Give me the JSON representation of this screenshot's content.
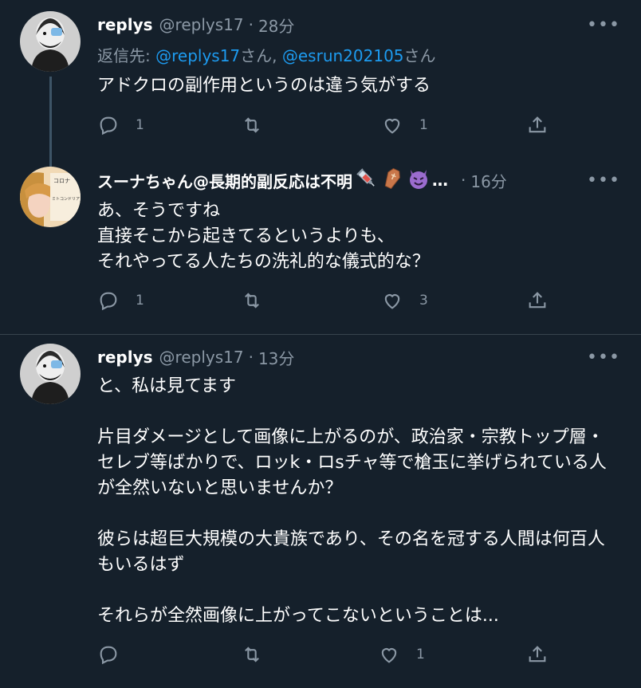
{
  "tweets": [
    {
      "name": "replys",
      "handle": "@replys17",
      "separator": "·",
      "time": "28分",
      "reply_prefix": "返信先: ",
      "reply_mention_1": "@replys17",
      "reply_san_1": "さん, ",
      "reply_mention_2": "@esrun202105",
      "reply_san_2": "さん",
      "text": "アドクロの副作用というのは違う気がする",
      "reply_count": "1",
      "retweet_count": "",
      "like_count": "1"
    },
    {
      "name": "スーナちゃん@長期的副反応は不明",
      "name_ellipsis": "…",
      "separator": "·",
      "time": "16分",
      "avatar_text": [
        "コロナ",
        "ミトコンドリア"
      ],
      "text": "あ、そうですね\n直接そこから起きてるというよりも、\nそれやってる人たちの洗礼的な儀式的な？",
      "reply_count": "1",
      "retweet_count": "",
      "like_count": "3"
    },
    {
      "name": "replys",
      "handle": "@replys17",
      "separator": "·",
      "time": "13分",
      "text": "と、私は見てます\n\n片目ダメージとして画像に上がるのが、政治家・宗教トップ層・セレブ等ばかりで、ロッk・ロsチャ等で槍玉に挙げられている人が全然いないと思いませんか？\n\n彼らは超巨大規模の大貴族であり、その名を冠する人間は何百人もいるはず\n\nそれらが全然画像に上がってこないということは...",
      "reply_count": "",
      "retweet_count": "",
      "like_count": "1"
    }
  ],
  "icons": [
    "more-icon",
    "reply-icon",
    "retweet-icon",
    "like-icon",
    "share-icon",
    "syringe-icon",
    "coffin-icon",
    "devil-icon"
  ],
  "colors": {
    "background": "#15202b",
    "secondary_text": "#8b98a5",
    "link": "#1d9bf0",
    "divider": "#38444d"
  }
}
